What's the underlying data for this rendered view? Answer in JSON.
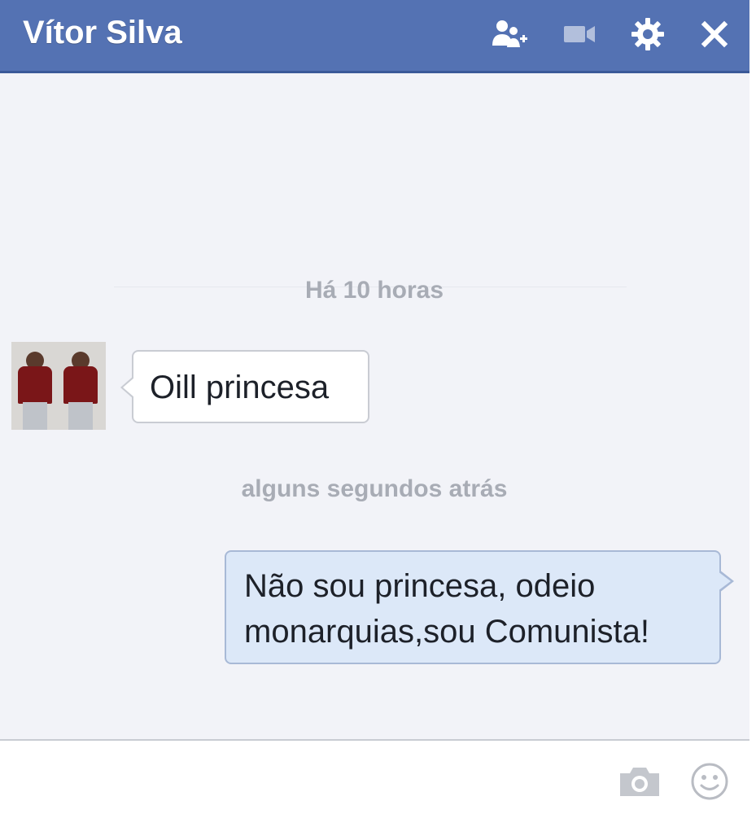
{
  "header": {
    "title": "Vítor Silva",
    "icons": [
      "add-people-icon",
      "video-call-icon",
      "gear-icon",
      "close-icon"
    ],
    "background_color": "#5472b3"
  },
  "messages": {
    "timestamp_1": "Há 10 horas",
    "incoming_text": "Oill princesa",
    "timestamp_2": "alguns segundos atrás",
    "outgoing_line_1": "Não sou princesa, odeio",
    "outgoing_line_2": "monarquias,sou Comunista!",
    "outgoing_bubble_color": "#dce8f8"
  },
  "composer": {
    "value": "",
    "icons": [
      "camera-icon",
      "emoji-icon"
    ]
  }
}
